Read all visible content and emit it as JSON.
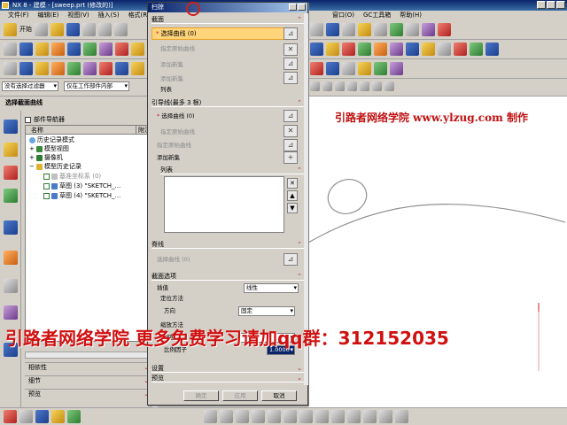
{
  "app": {
    "title": "NX 8 - 建模 - [sweep.prt (修改的)]",
    "menus_left": [
      "文件(F)",
      "编辑(E)",
      "视图(V)",
      "插入(S)",
      "格式(R)"
    ],
    "menus_right": [
      "窗口(O)",
      "GC工具箱",
      "帮助(H)"
    ],
    "start_label": "开始",
    "filter_select": "没有选择过滤器",
    "filter_scope": "仅在工作部件内部"
  },
  "navigator": {
    "title": "选择截面曲线",
    "header_label": "部件导航器",
    "col_name": "名称",
    "col_attached": "附注",
    "items": [
      {
        "label": "历史记录模式"
      },
      {
        "label": "模型视图"
      },
      {
        "label": "摄像机"
      },
      {
        "label": "模型历史记录"
      },
      {
        "label": "基准坐标系 (0)"
      },
      {
        "label": "草图 (3) \"SKETCH_..."
      },
      {
        "label": "草图 (4) \"SKETCH_..."
      }
    ],
    "sections": [
      "相依性",
      "细节",
      "预览"
    ]
  },
  "dialog": {
    "title": "扫掠",
    "section_section": "截面",
    "select_curve": "选择曲线 (0)",
    "specify_origin": "指定原始曲线",
    "add_new_set": "添加新集",
    "list_label": "列表",
    "guides_section": "引导线(最多 3 根)",
    "guide_select_curve": "选择曲线 (0)",
    "guide_specify_origin": "指定原始曲线",
    "guide_add_new_set": "添加新集",
    "guide_list_label": "列表",
    "spine_section": "脊线",
    "spine_select_curve": "选择曲线 (0)",
    "section_options": "截面选项",
    "interpolation_label": "插值",
    "interpolation_value": "线性",
    "orientation_label": "定位方法",
    "direction_label": "方向",
    "direction_value": "固定",
    "scaling_label": "缩放方法",
    "scaling_sub": "缩放",
    "scale_factor_label": "比例因子",
    "scale_factor_value": "1.0000",
    "settings_label": "设置",
    "preview_label": "预览",
    "ok_label": "确定",
    "apply_label": "应用",
    "cancel_label": "取消"
  },
  "watermark": {
    "top": "引路者网络学院 www.ylzug.com 制作",
    "bottom": "引路者网络学院  更多免费学习请加qq群：312152035"
  }
}
